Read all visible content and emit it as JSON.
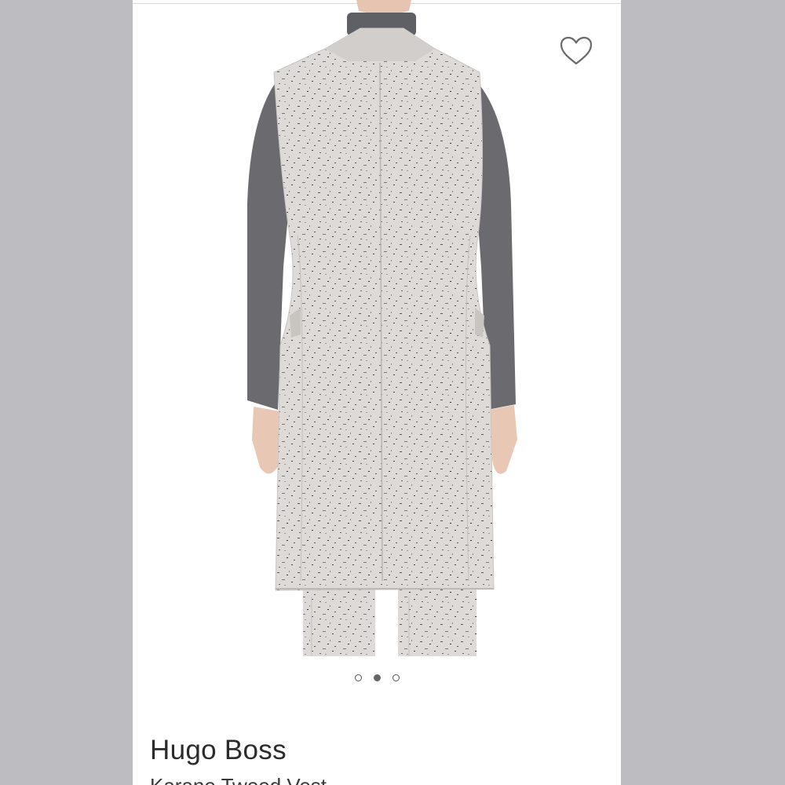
{
  "product": {
    "brand": "Hugo Boss",
    "name": "Karane Tweed Vest",
    "image_alt": "Back view of woman wearing a long light-grey tweed vest over a charcoal long-sleeve turtleneck"
  },
  "gallery": {
    "total_images": 3,
    "active_index": 2
  },
  "icons": {
    "favorite": "heart-outline-icon"
  },
  "colors": {
    "background": "#bdbcc1",
    "vest": "#dcd9d6",
    "sleeve": "#6a6a6d",
    "skin": "#e8c8b5"
  }
}
